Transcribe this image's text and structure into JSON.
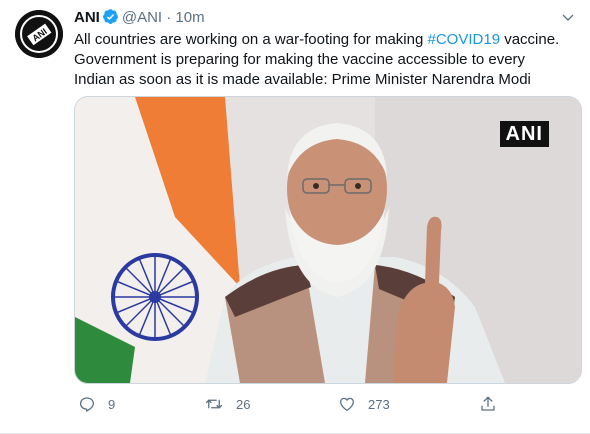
{
  "tweet": {
    "name": "ANI",
    "handle": "@ANI",
    "separator": "·",
    "time": "10m",
    "text_before": "All countries are working on a war-footing for making ",
    "hashtag": "#COVID19",
    "text_after": " vaccine. Government is preparing for making the vaccine accessible to every Indian as soon as it is made available: Prime Minister Narendra Modi",
    "media_watermark": "ANI"
  },
  "actions": {
    "replies": "9",
    "retweets": "26",
    "likes": "273"
  },
  "colors": {
    "accent": "#1b95e0",
    "muted": "#5b7083",
    "verified": "#1da1f2"
  },
  "icons": [
    "ani-logo-avatar",
    "verified-badge-icon",
    "chevron-down-icon",
    "reply-icon",
    "retweet-icon",
    "like-icon",
    "share-icon"
  ]
}
